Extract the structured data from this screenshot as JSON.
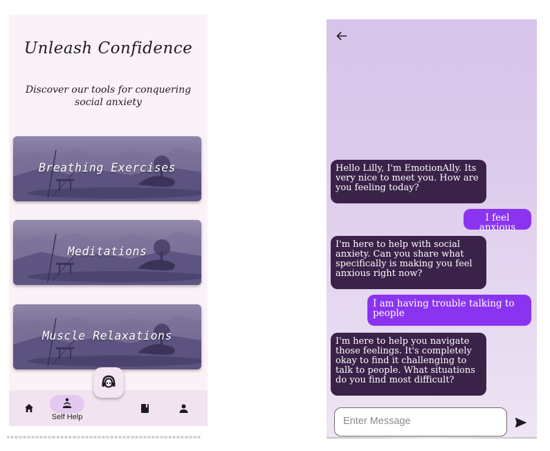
{
  "self_help_screen": {
    "title": "Unleash Confidence",
    "subtitle": "Discover our tools for conquering social anxiety",
    "cards": [
      {
        "label": "Breathing Exercises"
      },
      {
        "label": "Meditations"
      },
      {
        "label": "Muscle Relaxations"
      }
    ],
    "fab_icon": "support-agent-icon",
    "bottom_nav": {
      "items": [
        {
          "icon": "home-icon",
          "label": ""
        },
        {
          "icon": "meditation-icon",
          "label": "Self Help",
          "selected": true
        },
        {
          "icon": "book-icon",
          "label": ""
        },
        {
          "icon": "person-icon",
          "label": ""
        }
      ]
    }
  },
  "chat_screen": {
    "back_icon": "arrow-left-icon",
    "messages": [
      {
        "sender": "bot",
        "text": "Hello Lilly, I'm EmotionAlly. Its very nice to meet you. How are you feeling today?"
      },
      {
        "sender": "user",
        "text": "I feel anxious"
      },
      {
        "sender": "bot",
        "text": "I'm here to help with social anxiety. Can you share what specifically is making you feel anxious right now?"
      },
      {
        "sender": "user",
        "text": "I am having trouble talking to people"
      },
      {
        "sender": "bot",
        "text": "I'm here to help you navigate those feelings. It's completely okay to find it challenging to talk to people. What situations do you find most difficult?"
      }
    ],
    "input": {
      "placeholder": "Enter Message",
      "value": ""
    },
    "send_icon": "send-icon"
  },
  "colors": {
    "bot_bubble": "#3a2248",
    "user_bubble": "#8a34f0",
    "nav_selected": "#e3c8ef",
    "screen_bg": "#fbf2f8"
  }
}
